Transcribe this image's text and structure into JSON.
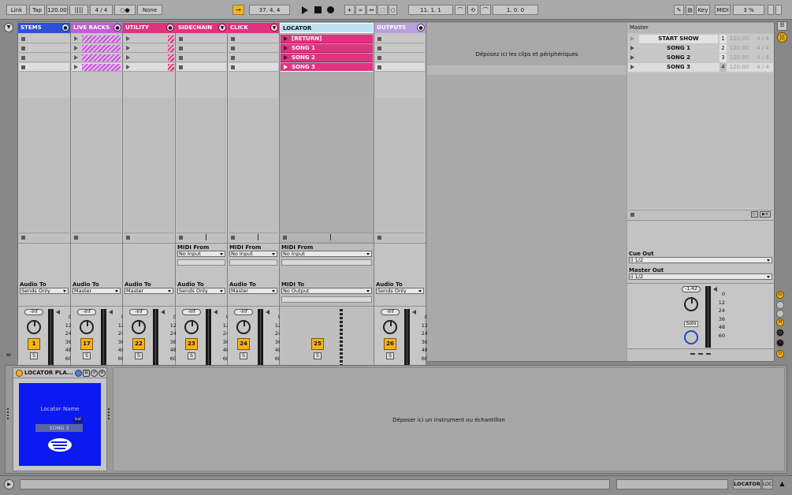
{
  "transport": {
    "link": "Link",
    "tap": "Tap",
    "tempo": "120.00",
    "signature": "4 / 4",
    "metro": "○●",
    "quantize": "None",
    "position": "37.  4.  4",
    "loop_start": "11.  1.  1",
    "loop_length": "1.  0.  0",
    "key": "Key",
    "midi": "MIDI",
    "cpu": "3 %"
  },
  "tracks": [
    {
      "name": "STEMS",
      "color": "#2f4fd6",
      "num": "1",
      "vol": "-Inf",
      "audio_to_label": "Audio To",
      "audio_to": "Sends Only"
    },
    {
      "name": "LIVE RACKS",
      "color": "#c35bd4",
      "num": "17",
      "vol": "-Inf",
      "audio_to_label": "Audio To",
      "audio_to": "Master"
    },
    {
      "name": "UTILITY",
      "color": "#e0337f",
      "num": "22",
      "vol": "-Inf",
      "audio_to_label": "Audio To",
      "audio_to": "Master"
    },
    {
      "name": "SIDECHAIN",
      "color": "#e0337f",
      "num": "23",
      "vol": "-Inf",
      "midi_from_label": "MIDI From",
      "midi_from": "No Input",
      "audio_to_label": "Audio To",
      "audio_to": "Sends Only"
    },
    {
      "name": "CLICK",
      "color": "#e0337f",
      "num": "24",
      "vol": "-Inf",
      "midi_from_label": "MIDI From",
      "midi_from": "No Input",
      "audio_to_label": "Audio To",
      "audio_to": "Master"
    },
    {
      "name": "LOCATOR",
      "color": "#bde3f2",
      "num": "25",
      "midi_from_label": "MIDI From",
      "midi_from": "No Input",
      "midi_to_label": "MIDI To",
      "midi_to": "No Output",
      "clips": [
        "[RETURN]",
        "SONG 1",
        "SONG 2",
        "SONG 3"
      ]
    },
    {
      "name": "OUTPUTS",
      "color": "#b8a0d8",
      "num": "26",
      "vol": "-Inf",
      "audio_to_label": "Audio To",
      "audio_to": "Sends Only"
    }
  ],
  "meter_scale": [
    "0",
    "12",
    "24",
    "36",
    "48",
    "60"
  ],
  "session_drop": "Déposez ici les clips et périphériques",
  "master": {
    "title": "Master",
    "scenes": [
      {
        "name": "START SHOW",
        "num": "1",
        "tempo": "120.00",
        "sig": "4 / 4"
      },
      {
        "name": "SONG 1",
        "num": "2",
        "tempo": "120.00",
        "sig": "4 / 4"
      },
      {
        "name": "SONG 2",
        "num": "3",
        "tempo": "120.00",
        "sig": "4 / 4"
      },
      {
        "name": "SONG 3",
        "num": "4",
        "tempo": "120.00",
        "sig": "4 / 4"
      }
    ],
    "cue_out_label": "Cue Out",
    "cue_out": "ii 1/2",
    "master_out_label": "Master Out",
    "master_out": "ii 1/2",
    "vol": "-1.42",
    "solo": "Solo"
  },
  "device": {
    "title": "LOCATOR PLA...",
    "screen_label": "Locator Name",
    "song": "SONG 3",
    "badge": "bal",
    "drop": "Déposer ici un instrument ou échantillon",
    "accent": "#0a1af0"
  },
  "statusbar": {
    "track": "LOCATOR",
    "loc": "LOC"
  }
}
